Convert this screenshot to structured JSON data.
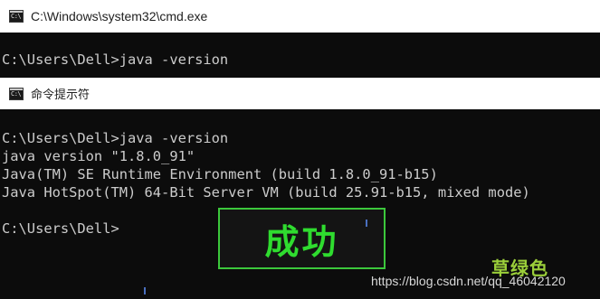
{
  "window1": {
    "title": "C:\\Windows\\system32\\cmd.exe",
    "icon": "cmd-icon",
    "lines": [
      "C:\\Users\\Dell>java -version"
    ]
  },
  "window2": {
    "title": "命令提示符",
    "icon": "cmd-icon",
    "lines": [
      "C:\\Users\\Dell>java -version",
      "java version \"1.8.0_91\"",
      "Java(TM) SE Runtime Environment (build 1.8.0_91-b15)",
      "Java HotSpot(TM) 64-Bit Server VM (build 25.91-b15, mixed mode)",
      "",
      "C:\\Users\\Dell>"
    ]
  },
  "annotation": {
    "text": "成功",
    "color": "#2fdc2f",
    "border_color": "#3cc83c"
  },
  "watermark": {
    "url": "https://blog.csdn.net/qq_46042120",
    "logo": "草绿色"
  }
}
